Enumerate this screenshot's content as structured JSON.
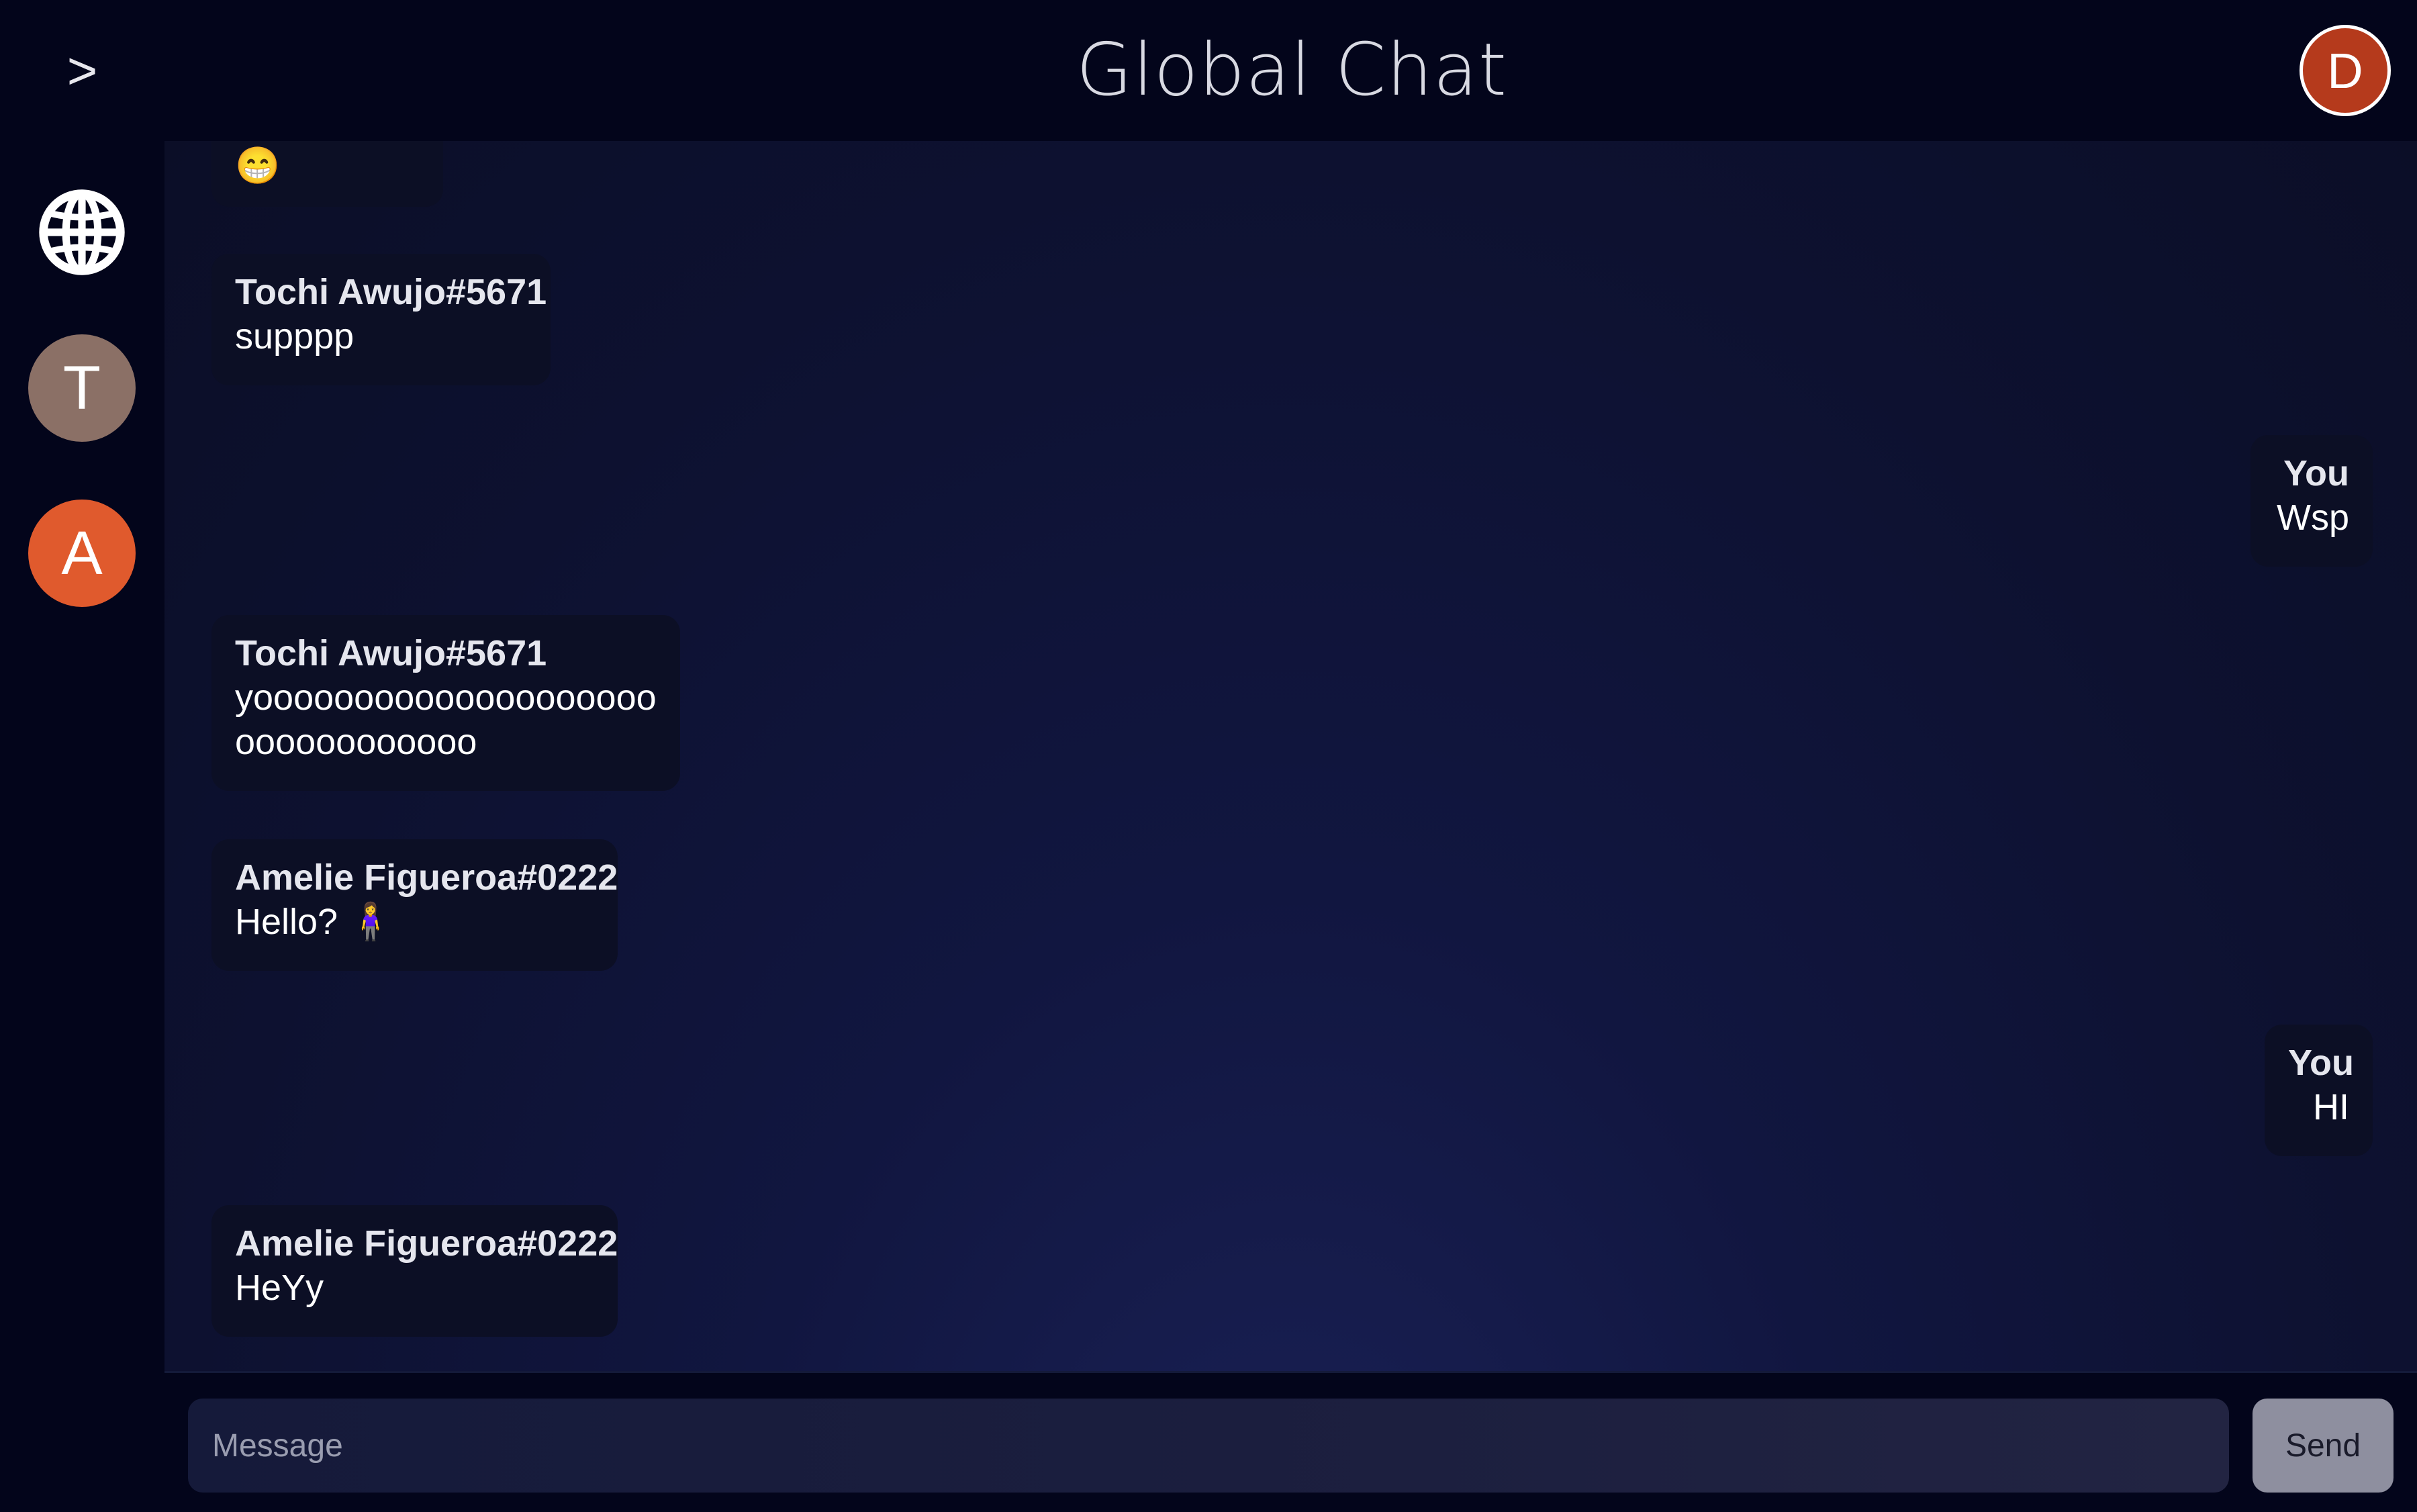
{
  "header": {
    "toggle_label": ">",
    "title": "Global Chat",
    "user_initial": "D"
  },
  "sidebar": {
    "items": [
      {
        "type": "global",
        "icon": "globe-icon"
      },
      {
        "type": "user",
        "initial": "T",
        "color": "#8b7066"
      },
      {
        "type": "user",
        "initial": "A",
        "color": "#e05a2d"
      }
    ]
  },
  "messages": [
    {
      "author": "",
      "text": "😁",
      "mine": false
    },
    {
      "author": "Tochi Awujo#5671",
      "text": "supppp",
      "mine": false
    },
    {
      "author": "You",
      "text": "Wsp",
      "mine": true
    },
    {
      "author": "Tochi Awujo#5671",
      "text": "yoooooooooooooooooooooooooooooooo",
      "mine": false
    },
    {
      "author": "Amelie Figueroa#0222",
      "text": "Hello? 🧍‍♀️",
      "mine": false
    },
    {
      "author": "You",
      "text": "HI",
      "mine": true
    },
    {
      "author": "Amelie Figueroa#0222",
      "text": "HeYy",
      "mine": false
    }
  ],
  "composer": {
    "placeholder": "Message",
    "send_label": "Send"
  },
  "colors": {
    "background": "#03051b",
    "bubble": "#0c0f25",
    "user_avatar": "#b53a1c",
    "send_button": "#8e8f9f"
  }
}
